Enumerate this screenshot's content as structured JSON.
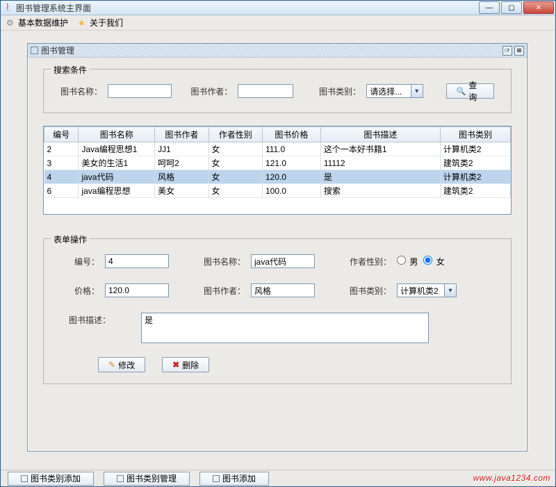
{
  "window": {
    "title": "图书管理系统主界面"
  },
  "menubar": {
    "basic_maint": "基本数据维护",
    "about_us": "关于我们"
  },
  "internal": {
    "title": "图书管理"
  },
  "search_group": {
    "legend": "搜索条件",
    "book_name_label": "图书名称：",
    "book_name_value": "",
    "book_author_label": "图书作者：",
    "book_author_value": "",
    "book_category_label": "图书类别：",
    "book_category_value": "请选择...",
    "query_btn": "查询"
  },
  "table": {
    "headers": [
      "编号",
      "图书名称",
      "图书作者",
      "作者性别",
      "图书价格",
      "图书描述",
      "图书类别"
    ],
    "rows": [
      {
        "cells": [
          "2",
          "Java编程思想1",
          "JJ1",
          "女",
          "111.0",
          "这个一本好书籍1",
          "计算机类2"
        ],
        "selected": false
      },
      {
        "cells": [
          "3",
          "美女的生活1",
          "呵呵2",
          "女",
          "121.0",
          "11112",
          "建筑类2"
        ],
        "selected": false
      },
      {
        "cells": [
          "4",
          "java代码",
          "风格",
          "女",
          "120.0",
          "是",
          "计算机类2"
        ],
        "selected": true
      },
      {
        "cells": [
          "6",
          "java编程思想",
          "美女",
          "女",
          "100.0",
          "搜索",
          "建筑类2"
        ],
        "selected": false
      }
    ]
  },
  "form_group": {
    "legend": "表单操作",
    "id_label": "编号：",
    "id_value": "4",
    "name_label": "图书名称：",
    "name_value": "java代码",
    "gender_label": "作者性别：",
    "gender_male": "男",
    "gender_female": "女",
    "gender_selected": "female",
    "price_label": "价格：",
    "price_value": "120.0",
    "author_label": "图书作者：",
    "author_value": "风格",
    "category_label": "图书类别：",
    "category_value": "计算机类2",
    "desc_label": "图书描述：",
    "desc_value": "是",
    "modify_btn": "修改",
    "delete_btn": "删除"
  },
  "taskbar": {
    "cat_add": "图书类别添加",
    "cat_manage": "图书类别管理",
    "book_add": "图书添加"
  },
  "watermark": "www.java1234.com"
}
